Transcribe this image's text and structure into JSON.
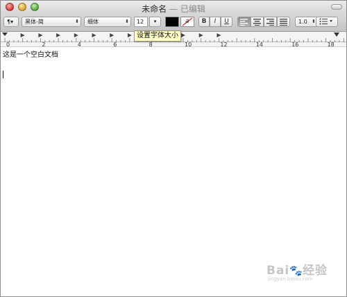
{
  "window": {
    "title": "未命名",
    "title_suffix": " — 已编辑"
  },
  "toolbar": {
    "paragraph_label": "¶▾",
    "font_family": "黑体-简",
    "font_style": "细体",
    "font_size": "12",
    "font_size_dropdown": "▾",
    "text_color": "#000000",
    "highlight_label": "a",
    "bold_label": "B",
    "italic_label": "I",
    "underline_label": "U",
    "line_spacing": "1.0",
    "stepper_arrows": "⬍"
  },
  "tooltip": {
    "text": "设置字体大小"
  },
  "ruler": {
    "labels": [
      "0",
      "2",
      "4",
      "6",
      "8",
      "10",
      "12",
      "14",
      "16",
      "18"
    ]
  },
  "document": {
    "line1": "这是一个空白文档"
  },
  "watermark": {
    "text": "Bai",
    "paw": "🐾",
    "text2": "经验",
    "sub": "jingyan.baidu.com"
  }
}
